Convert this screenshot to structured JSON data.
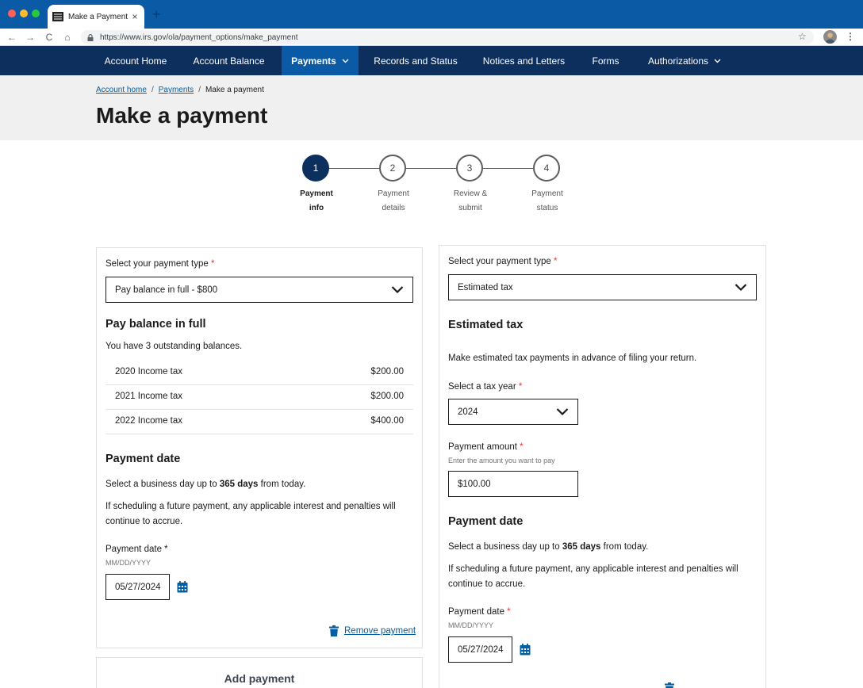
{
  "browser": {
    "tab_title": "Make a Payment",
    "tab_close": "×",
    "new_tab": "+",
    "url": "https://www.irs.gov/ola/payment_options/make_payment",
    "back": "←",
    "forward": "→",
    "reload": "C",
    "home": "⌂",
    "star": "☆",
    "menu": "⋮"
  },
  "nav": {
    "items": [
      {
        "label": "Account Home"
      },
      {
        "label": "Account Balance"
      },
      {
        "label": "Payments"
      },
      {
        "label": "Records and Status"
      },
      {
        "label": "Notices and Letters"
      },
      {
        "label": "Forms"
      },
      {
        "label": "Authorizations"
      }
    ]
  },
  "header": {
    "breadcrumb": [
      {
        "label": "Account home"
      },
      {
        "label": "Payments"
      },
      {
        "label": "Make a payment"
      }
    ],
    "separator": "/",
    "title": "Make a payment"
  },
  "stepper": {
    "steps": [
      {
        "number": "1",
        "line1": "Payment",
        "line2": "info"
      },
      {
        "number": "2",
        "line1": "Payment",
        "line2": "details"
      },
      {
        "number": "3",
        "line1": "Review &",
        "line2": "submit"
      },
      {
        "number": "4",
        "line1": "Payment",
        "line2": "status"
      }
    ],
    "current_step": 1
  },
  "left_card": {
    "type_label": "Select your payment type",
    "required_mark": "*",
    "type_value": "Pay balance in full - $800",
    "section_title": "Pay balance in full",
    "outstanding_text": "You have 3 outstanding balances.",
    "balances": [
      {
        "name": "2020 Income tax",
        "amount": "$200.00"
      },
      {
        "name": "2021 Income tax",
        "amount": "$200.00"
      },
      {
        "name": "2022 Income tax",
        "amount": "$400.00"
      }
    ],
    "date_title": "Payment date",
    "date_text_pre": "Select a business day up to ",
    "date_text_bold": "365 days",
    "date_text_post": " from today.",
    "interest_text": "If scheduling a future payment, any applicable interest and penalties will continue to accrue.",
    "date_label": "Payment date *",
    "date_hint": "MM/DD/YYYY",
    "date_value": "05/27/2024",
    "remove_label": "Remove payment"
  },
  "right_card": {
    "type_label": "Select your payment type",
    "required_mark": "*",
    "type_value": "Estimated tax",
    "section_title": "Estimated tax",
    "description": "Make estimated tax payments in advance of filing your return.",
    "tax_year_label": "Select a tax year",
    "tax_year_value": "2024",
    "amount_label": "Payment amount",
    "amount_hint": "Enter the amount you want to pay",
    "amount_value": "$100.00",
    "date_title": "Payment date",
    "date_text_pre": "Select a business day up to ",
    "date_text_bold": "365 days",
    "date_text_post": " from today.",
    "interest_text": "If scheduling a future payment, any applicable interest and penalties will continue to accrue.",
    "date_label": "Payment date",
    "date_hint": "MM/DD/YYYY",
    "date_value": "05/27/2024"
  },
  "add_payment": {
    "label": "Add payment"
  },
  "colors": {
    "nav_bg": "#0c2f5e",
    "nav_active": "#0b5aa6",
    "link": "#005ea2",
    "required": "#d83933"
  }
}
